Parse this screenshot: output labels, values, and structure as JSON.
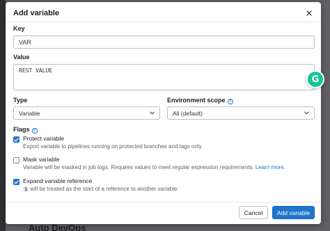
{
  "modal": {
    "title": "Add variable",
    "close_icon": "close-icon"
  },
  "key": {
    "label": "Key",
    "value": "VAR"
  },
  "value": {
    "label": "Value",
    "value": "REST VALUE"
  },
  "type": {
    "label": "Type",
    "selected": "Variable",
    "icon": "chevron-down-icon"
  },
  "environment_scope": {
    "label": "Environment scope",
    "help_icon": "question-icon",
    "selected": "All (default)",
    "icon": "chevron-down-icon"
  },
  "flags": {
    "label": "Flags",
    "help_icon": "question-icon",
    "items": [
      {
        "title": "Protect variable",
        "checked": true,
        "help": "Export variable to pipelines running on protected branches and tags only."
      },
      {
        "title": "Mask variable",
        "checked": false,
        "help": "Variable will be masked in job logs. Requires values to meet regular expression requirements.",
        "link": "Learn more."
      },
      {
        "title": "Expand variable reference",
        "checked": true,
        "code": "$",
        "help": "will be treated as the start of a reference to another variable."
      }
    ]
  },
  "footer": {
    "cancel_label": "Cancel",
    "submit_label": "Add variable"
  },
  "background": {
    "partial_heading": "Auto DevOps"
  },
  "extensions": {
    "grammarly_letter": "G"
  },
  "colors": {
    "primary": "#1f75cb",
    "grammarly": "#15c39a",
    "backdrop": "#5f5f63"
  }
}
